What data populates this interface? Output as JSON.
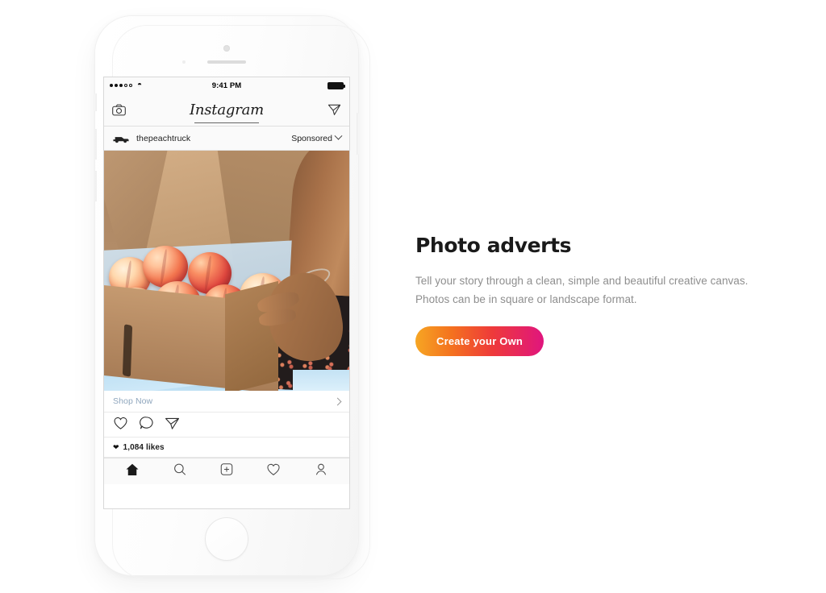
{
  "phone": {
    "status_bar": {
      "signal_dots_filled": 3,
      "signal_dots_total": 5,
      "wifi_icon": "wifi-icon",
      "time": "9:41 PM",
      "battery_icon": "battery-full-icon"
    },
    "ig_header": {
      "camera_icon": "camera-icon",
      "logo": "Instagram",
      "send_icon": "paper-plane-icon"
    },
    "post_header": {
      "avatar_icon": "truck-avatar-icon",
      "username": "thepeachtruck",
      "sponsored_label": "Sponsored",
      "chevron_icon": "chevron-down-icon"
    },
    "photo": {
      "alt": "Hands holding a cardboard box full of fresh peaches"
    },
    "cta_bar": {
      "label": "Shop Now",
      "chevron_icon": "chevron-right-icon"
    },
    "actions": [
      {
        "icon": "heart-icon"
      },
      {
        "icon": "comment-icon"
      },
      {
        "icon": "paper-plane-icon"
      }
    ],
    "likes": {
      "heart_icon": "heart-filled-icon",
      "text": "1,084 likes"
    },
    "tabbar": [
      {
        "icon": "home-icon",
        "active": true
      },
      {
        "icon": "search-icon",
        "active": false
      },
      {
        "icon": "add-post-icon",
        "active": false
      },
      {
        "icon": "activity-heart-icon",
        "active": false
      },
      {
        "icon": "profile-icon",
        "active": false
      }
    ]
  },
  "panel": {
    "title": "Photo adverts",
    "body_line_1": "Tell your story through a clean, simple and beautiful creative canvas.",
    "body_line_2": "Photos can be in square or landscape format.",
    "cta_label": "Create your Own"
  },
  "colors": {
    "cta_gradient_start": "#F6A623",
    "cta_gradient_end": "#E0157E",
    "title": "#1A1A1A",
    "body_text": "#8E8E8E",
    "shop_now_link": "#8FA6BD",
    "page_background": "#FFFFFF"
  }
}
